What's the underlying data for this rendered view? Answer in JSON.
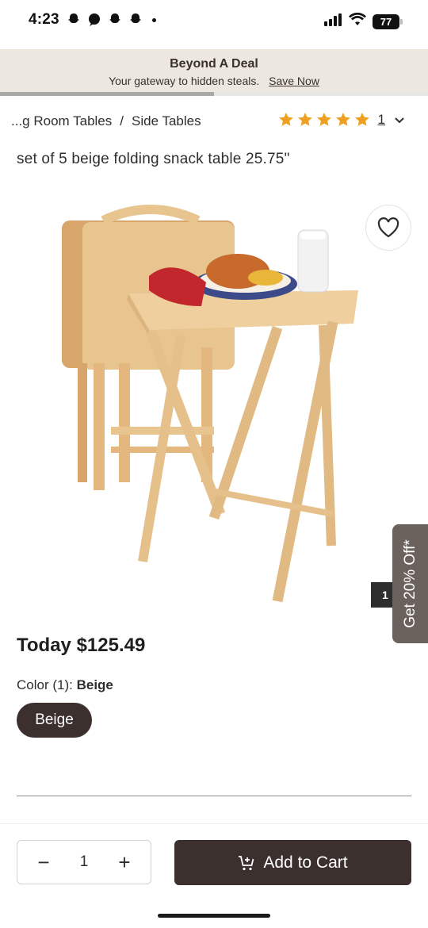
{
  "status_bar": {
    "time": "4:23",
    "battery": "77"
  },
  "promo": {
    "title": "Beyond A Deal",
    "subtitle": "Your gateway to hidden steals.",
    "link": "Save Now",
    "progress": 0.5
  },
  "breadcrumb": {
    "first": "...g Room Tables",
    "separator": "/",
    "second": "Side Tables"
  },
  "rating": {
    "stars": 5,
    "count": "1"
  },
  "product": {
    "title": "set of 5 beige folding snack table 25.75\""
  },
  "image": {
    "counter": "1",
    "side_tab": "Get 20% Off*"
  },
  "price": {
    "label": "Today $125.49"
  },
  "color": {
    "label": "Color (1):",
    "selected": "Beige",
    "swatch_label": "Beige"
  },
  "cart": {
    "quantity": "1",
    "minus": "−",
    "plus": "+",
    "add_label": "Add to Cart"
  },
  "colors": {
    "brand_dark": "#3b302d",
    "star": "#f0a020",
    "promo_bg": "#ece8df",
    "side_tab": "#6b625e"
  }
}
